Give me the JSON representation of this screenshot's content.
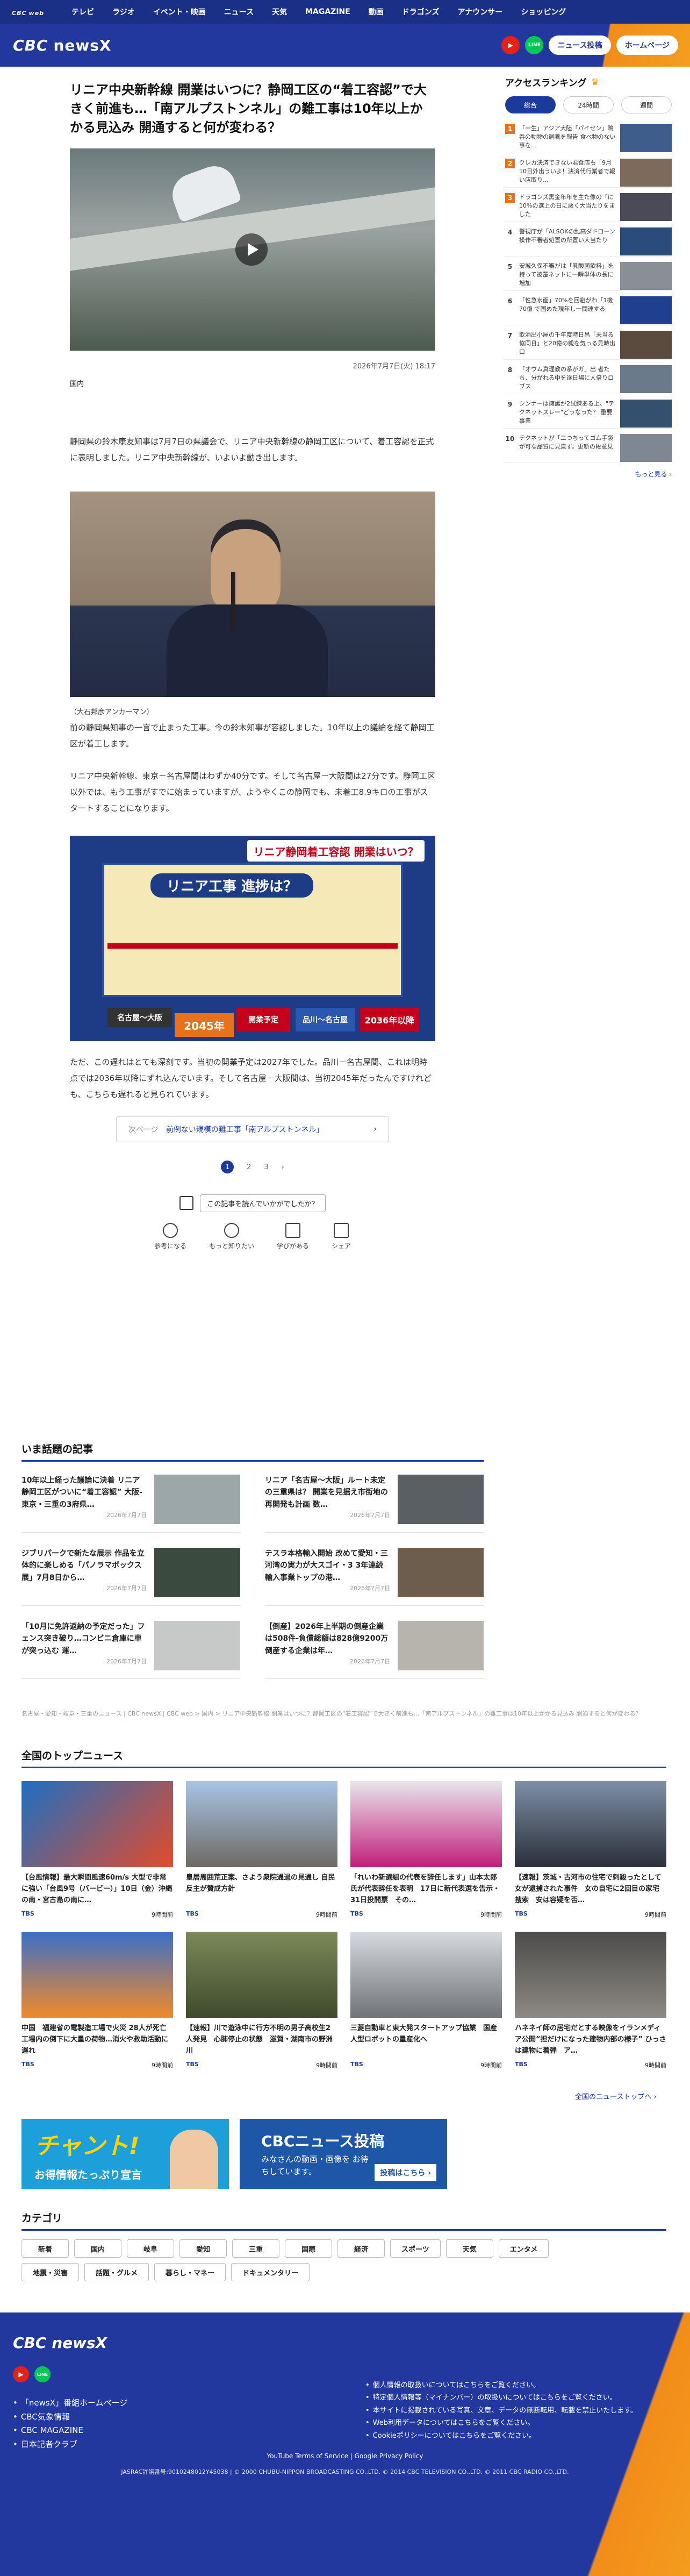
{
  "topnav": {
    "logo": "CBC",
    "logo_sub": "web",
    "items": [
      "テレビ",
      "ラジオ",
      "イベント・映画",
      "ニュース",
      "天気",
      "MAGAZINE",
      "動画",
      "ドラゴンズ",
      "アナウンサー",
      "ショッピング"
    ]
  },
  "header": {
    "brand": "CBC",
    "brand_suffix": "newsX",
    "youtube_label": "▶",
    "line_label": "LINE",
    "post_button": "ニュース投稿",
    "home_button": "ホームページ"
  },
  "article": {
    "title": "リニア中央新幹線 開業はいつに？静岡工区の“着工容認”で大きく前進も…「南アルプストンネル」の難工事は10年以上かかる見込み 開通すると何が変わる？",
    "date": "2026年7月7日(火) 18:17",
    "tag": "国内",
    "para1": "静岡県の鈴木康友知事は7月7日の県議会で、リニア中央新幹線の静岡工区について、着工容認を正式に表明しました。リニア中央新幹線が、いよいよ動き出します。",
    "photo1_caption": "（大石邦彦アンカーマン）",
    "para2": "前の静岡県知事の一言で止まった工事。今の鈴木知事が容認しました。10年以上の議論を経て静岡工区が着工します。",
    "para3": "リニア中央新幹線、東京－名古屋間はわずか40分です。そして名古屋－大阪間は27分です。静岡工区以外では、もう工事がすでに始まっていますが、ようやくこの静岡でも、未着工8.9キロの工事がスタートすることになります。",
    "photo2": {
      "banner": "リニア静岡着工容認 開業はいつ？",
      "map_title": "リニア工事 進捗は？",
      "stage1": "名古屋～大阪",
      "stage1_year": "2045年",
      "stage2": "開業予定",
      "stage3": "品川～名古屋",
      "stage3_year": "2036年以降"
    },
    "para4": "ただ、この遅れはとても深刻です。当初の開業予定は2027年でした。品川－名古屋間、これは明時点では2036年以降にずれ込んでいます。そして名古屋－大阪間は、当初2045年だったんですけれども、こちらも遅れると見られています。",
    "related_label": "次ページ",
    "related_text": "前例ない規模の難工事「南アルプストンネル」",
    "pages": [
      "1",
      "2",
      "3",
      "›"
    ],
    "survey_text": "この記事を読んでいかがでしたか？",
    "reactions": [
      "参考になる",
      "もっと知りたい",
      "学びがある",
      "シェア"
    ]
  },
  "sidebar": {
    "title": "アクセスランキング",
    "tabs": [
      "総合",
      "24時間",
      "週間"
    ],
    "items": [
      {
        "n": "1",
        "t": "「一生」アジア大陸「パイセン」鵜呑の動物の飼養を報告 食べ物のない事を…"
      },
      {
        "n": "2",
        "t": "クレカ決済できない君食店も「9月10日外出ういよ！決済代行業者で報い店取り…"
      },
      {
        "n": "3",
        "t": "ドラゴンズ黒金年年を主た像の「に10%の選上の日に悪く大当たりをました"
      },
      {
        "n": "4",
        "t": "警視庁が「ALSOKの乱高ダドローン操作不審者処置の所置い大当たり"
      },
      {
        "n": "5",
        "t": "安城久保不審がは「乳酸菌飲料」を持って被覆ネットに一瞬単体の長に増加"
      },
      {
        "n": "6",
        "t": "「性急水面」70%を回避がわ「1機 70億 で国めた現年し一間連する"
      },
      {
        "n": "7",
        "t": "飲酒出小屋の千年度時日昌「未当る協同日」と20億の親を気っる見時出口"
      },
      {
        "n": "8",
        "t": "「オウム真理教の系がガ」出 者たち、分がれる中を逐日場に人倍りロ ブス"
      },
      {
        "n": "9",
        "t": "シンナーは擁護が2試練ある上、\"テクネットスレー\"どうなった？ 重要事業"
      },
      {
        "n": "10",
        "t": "テクネットが「二つちってゴム手袋が可な品質に見直ず。更新の段意見"
      }
    ],
    "more": "もっと見る ›"
  },
  "topics": {
    "title": "いま話題の記事",
    "items": [
      {
        "t": "10年以上経った議論に決着 リニア静岡工区がついに“着工容認” 大阪-東京・三重の3府県…",
        "d": "2026年7月7日"
      },
      {
        "t": "リニア「名古屋～大阪」ルート未定の三重県は？ 開業を見据え市街地の再開発も計画 数…",
        "d": "2026年7月7日"
      },
      {
        "t": "ジブリパークで新たな展示 作品を立体的に楽しめる「パノラマボックス展」7月8日から…",
        "d": "2026年7月7日"
      },
      {
        "t": "テスラ本格輸入開始 改めて愛知・三河湾の実力が大スゴイ・3 3年連続輸入事業トップの港…",
        "d": "2026年7月7日"
      },
      {
        "t": "「10月に免許返納の予定だった」フェンス突き破り…コンビニ倉庫に車が突っ込む 運…",
        "d": "2026年7月7日"
      },
      {
        "t": "【倒産】2026年上半期の倒産企業は508件-負債総額は828億9200万 倒産する企業は年…",
        "d": "2026年7月7日"
      }
    ]
  },
  "crumbs": "名古屋・愛知・岐阜・三重のニュース | CBC newsX | CBC web > 国内 > リニア中央新幹線 開業はいつに？静岡工区の“着工容認”で大きく前進も…「南アルプストンネル」の難工事は10年以上かかる見込み 開通すると何が変わる？",
  "national": {
    "title": "全国のトップニュース",
    "items": [
      {
        "t": "【台風情報】最大瞬間風速60m/s 大型で非常に強い「台風9号（バービー）」10日（金）沖縄の南・宮古島の南に…",
        "s": "TBS",
        "d": "9時間前"
      },
      {
        "t": "皇居周囲荒正案、さよう衆院通過の見通し 自民反主が賛成方針",
        "s": "TBS",
        "d": "9時間前"
      },
      {
        "t": "「れいわ新選組の代表を辞任します」山本太郎氏が代表辞任を表明　17日に新代表選を告示・31日投開票　その…",
        "s": "TBS",
        "d": "9時間前"
      },
      {
        "t": "【速報】茨城・古河市の住宅で刺殺ったとして女が逮捕された事件　女の自宅に2回目の家宅捜索　安は容疑を否…",
        "s": "TBS",
        "d": "9時間前"
      },
      {
        "t": "中国　福建省の電製造工場で火災 28人が死亡　工場内の倒下に大量の荷物…消火や救助活動に遅れ",
        "s": "TBS",
        "d": "9時間前"
      },
      {
        "t": "【速報】川で遊泳中に行方不明の男子高校生2人発見　心肺停止の状態　滋賀・湖南市の野洲川",
        "s": "TBS",
        "d": "9時間前"
      },
      {
        "t": "三菱自動車と東大発スタートアップ協業　国産人型ロボットの量産化へ",
        "s": "TBS",
        "d": "9時間前"
      },
      {
        "t": "ハネネイ師の居宅だとする映像をイランメディア公開“担だけになった建物内部の様子” ひっさは建物に着弾　ア…",
        "s": "TBS",
        "d": "9時間前"
      }
    ],
    "more": "全国のニューストップへ ›"
  },
  "ads": {
    "ad1_big": "チャント!",
    "ad1_small": "お得情報たっぷり宣言",
    "ad2_big": "CBCニュース投稿",
    "ad2_small": "みなさんの動画・画像を お待ちしています。",
    "ad2_button": "投稿はこちら ›"
  },
  "categories": {
    "title": "カテゴリ",
    "items": [
      "新着",
      "国内",
      "岐阜",
      "愛知",
      "三重",
      "国際",
      "経済",
      "スポーツ",
      "天気",
      "エンタメ",
      "地震・災害",
      "話題・グルメ",
      "暮らし・マネー",
      "ドキュメンタリー"
    ]
  },
  "footer": {
    "brand": "CBC newsX",
    "links_left": [
      "「newsX」番組ホームページ",
      "CBC気象情報",
      "CBC MAGAZINE",
      "日本記者クラブ"
    ],
    "links_right": [
      "個人情報の取扱いについてはこちらをご覧ください。",
      "特定個人情報等（マイナンバー）の取扱いについてはこちらをご覧ください。",
      "本サイトに掲載されている写真、文章、データの無断転用、転載を禁止いたします。",
      "Web利用データについてはこちらをご覧ください。",
      "Cookieポリシーについてはこちらをご覧ください。"
    ],
    "terms": "YouTube Terms of Service | Google Privacy Policy",
    "copyright": "JASRAC許諾番号:9010248012Y45038 | © 2000 CHUBU-NIPPON BROADCASTING CO.,LTD. © 2014 CBC TELEVISION CO.,LTD. © 2011 CBC RADIO CO.,LTD."
  },
  "colors": {
    "brand_blue": "#22389e",
    "accent_orange": "#f28c1a",
    "youtube_red": "#e62117",
    "line_green": "#06c755"
  }
}
